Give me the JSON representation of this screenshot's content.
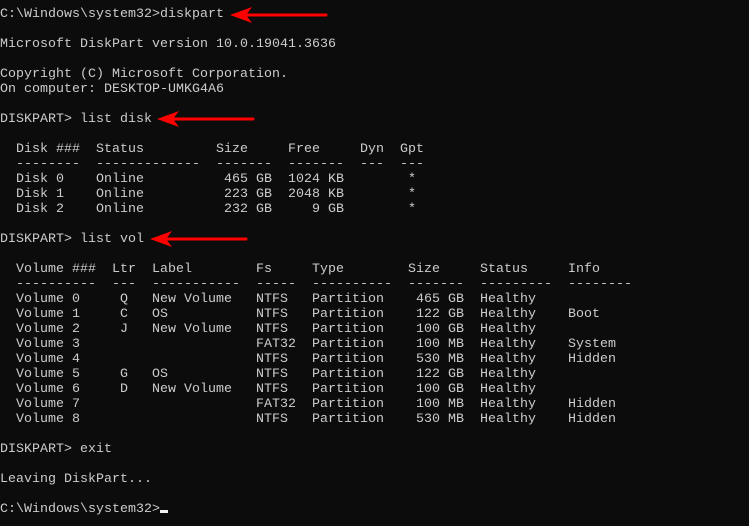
{
  "terminal": {
    "lines": [
      "C:\\Windows\\system32>diskpart",
      "",
      "Microsoft DiskPart version 10.0.19041.3636",
      "",
      "Copyright (C) Microsoft Corporation.",
      "On computer: DESKTOP-UMKG4A6",
      "",
      "DISKPART> list disk",
      "",
      "  Disk ###  Status         Size     Free     Dyn  Gpt",
      "  --------  -------------  -------  -------  ---  ---",
      "  Disk 0    Online          465 GB  1024 KB        *",
      "  Disk 1    Online          223 GB  2048 KB        *",
      "  Disk 2    Online          232 GB     9 GB        *",
      "",
      "DISKPART> list vol",
      "",
      "  Volume ###  Ltr  Label        Fs     Type        Size     Status     Info",
      "  ----------  ---  -----------  -----  ----------  -------  ---------  --------",
      "  Volume 0     Q   New Volume   NTFS   Partition    465 GB  Healthy",
      "  Volume 1     C   OS           NTFS   Partition    122 GB  Healthy    Boot",
      "  Volume 2     J   New Volume   NTFS   Partition    100 GB  Healthy",
      "  Volume 3                      FAT32  Partition    100 MB  Healthy    System",
      "  Volume 4                      NTFS   Partition    530 MB  Healthy    Hidden",
      "  Volume 5     G   OS           NTFS   Partition    122 GB  Healthy",
      "  Volume 6     D   New Volume   NTFS   Partition    100 GB  Healthy",
      "  Volume 7                      FAT32  Partition    100 MB  Healthy    Hidden",
      "  Volume 8                      NTFS   Partition    530 MB  Healthy    Hidden",
      "",
      "DISKPART> exit",
      "",
      "Leaving DiskPart...",
      "",
      "C:\\Windows\\system32>"
    ],
    "annotations": [
      {
        "name": "arrow-diskpart",
        "points_to": "diskpart"
      },
      {
        "name": "arrow-list-disk",
        "points_to": "list disk"
      },
      {
        "name": "arrow-list-vol",
        "points_to": "list vol"
      }
    ],
    "colors": {
      "background": "#0c0c0c",
      "text": "#cccccc",
      "arrow": "#ff0000"
    }
  }
}
